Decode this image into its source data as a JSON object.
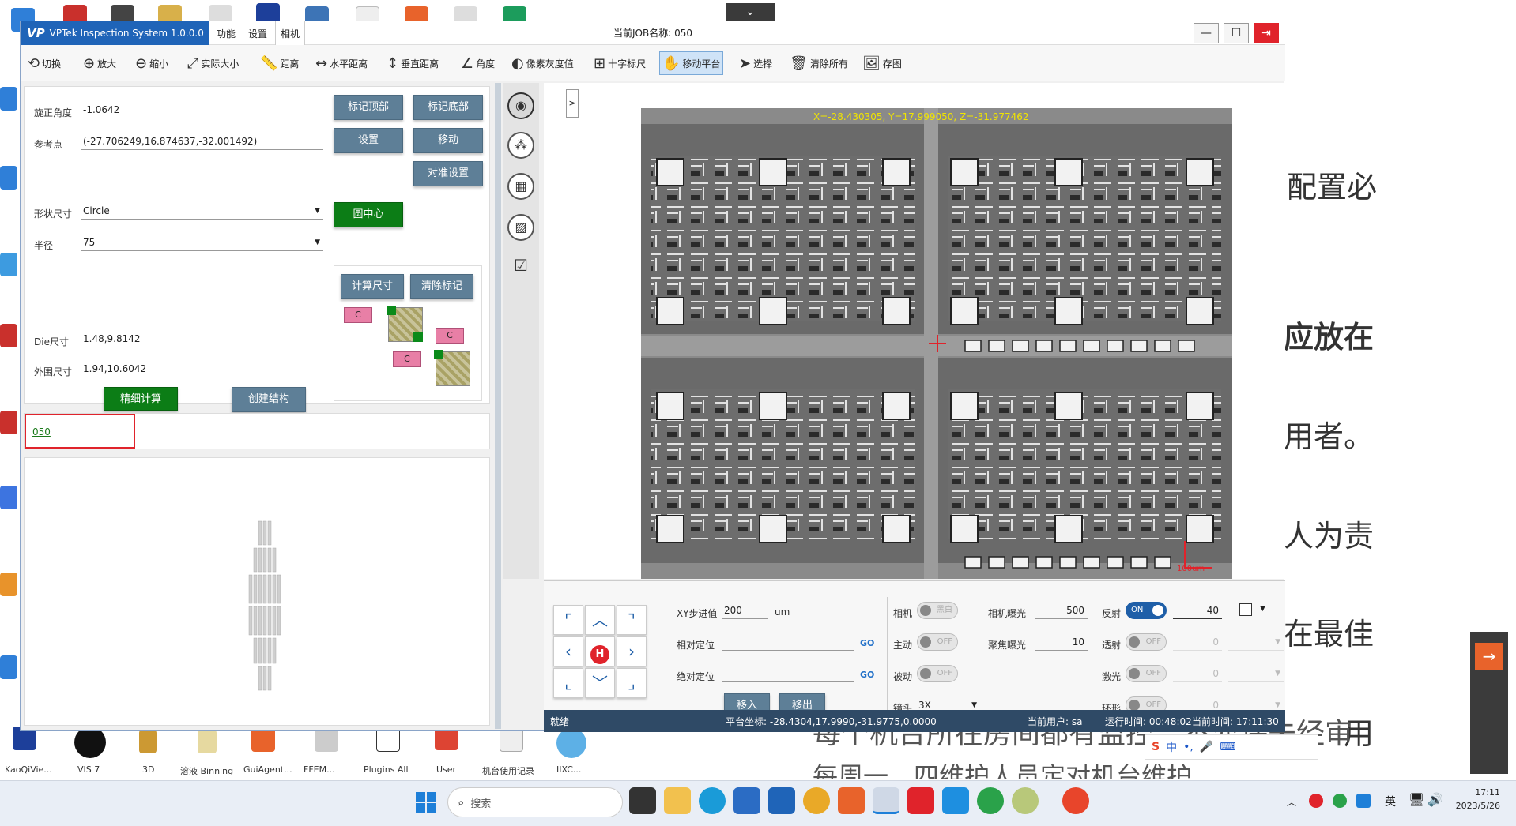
{
  "app": {
    "logo": "VP",
    "title": "VPTek Inspection System 1.0.0.0",
    "menu": [
      "功能",
      "设置",
      "相机"
    ],
    "job_label": "当前JOB名称: 050",
    "window_controls": [
      "minimize-icon",
      "maximize-icon",
      "exit-icon"
    ]
  },
  "toolbar": [
    {
      "icon": "refresh-icon",
      "label": "切换"
    },
    {
      "icon": "zoom-in-icon",
      "label": "放大"
    },
    {
      "icon": "zoom-out-icon",
      "label": "缩小"
    },
    {
      "icon": "fit-icon",
      "label": "实际大小"
    },
    {
      "icon": "ruler-icon",
      "label": "距离"
    },
    {
      "icon": "horizontal-distance-icon",
      "label": "水平距离"
    },
    {
      "icon": "vertical-distance-icon",
      "label": "垂直距离"
    },
    {
      "icon": "angle-icon",
      "label": "角度"
    },
    {
      "icon": "gray-value-icon",
      "label": "像素灰度值"
    },
    {
      "icon": "crosshair-icon",
      "label": "十字标尺"
    },
    {
      "icon": "hand-move-icon",
      "label": "移动平台"
    },
    {
      "icon": "pointer-icon",
      "label": "选择"
    },
    {
      "icon": "trash-icon",
      "label": "清除所有"
    },
    {
      "icon": "save-image-icon",
      "label": "存图"
    }
  ],
  "form": {
    "rotation_label": "旋正角度",
    "rotation_value": "-1.0642",
    "ref_label": "参考点",
    "ref_value": "(-27.706249,16.874637,-32.001492)",
    "shape_label": "形状尺寸",
    "shape_value": "Circle",
    "radius_label": "半径",
    "radius_value": "75",
    "die_label": "Die尺寸",
    "die_value": "1.48,9.8142",
    "outer_label": "外围尺寸",
    "outer_value": "1.94,10.6042",
    "btn_mark_top": "标记顶部",
    "btn_mark_bottom": "标记底部",
    "btn_setup": "设置",
    "btn_move": "移动",
    "btn_align": "对准设置",
    "btn_circle_center": "圆中心",
    "btn_calc_size": "计算尺寸",
    "btn_clear_mark": "清除标记",
    "btn_precise": "精细计算",
    "btn_create": "创建结构",
    "mark_letter": "C"
  },
  "job_link": "050",
  "image": {
    "coords_text": "X=-28.430305, Y=17.999050, Z=-31.977462",
    "scale_label": "100um",
    "expand_btn": ">"
  },
  "sidebar_icons": [
    "camera-icon",
    "bga-icon",
    "grid-icon",
    "image-icon",
    "checklist-icon"
  ],
  "motion": {
    "xy_step_label": "XY步进值",
    "xy_step_value": "200",
    "unit": "um",
    "rel_label": "相对定位",
    "abs_label": "绝对定位",
    "go": "GO",
    "home": "H",
    "move_in": "移入",
    "move_out": "移出"
  },
  "camera": {
    "camera_label": "相机",
    "camera_toggle": "黑白",
    "active_label": "主动",
    "passive_label": "被动",
    "off": "OFF",
    "on": "ON",
    "lens_label": "镜头",
    "lens_value": "3X",
    "exposure_label": "相机曝光",
    "exposure_value": "500",
    "focus_exp_label": "聚焦曝光",
    "focus_exp_value": "10",
    "reflect_label": "反射",
    "reflect_value": "40",
    "transmit_label": "透射",
    "transmit_value": "0",
    "laser_label": "激光",
    "laser_value": "0",
    "ring_label": "环形",
    "ring_value": "0"
  },
  "status": {
    "ready": "就绪",
    "platform": "平台坐标: -28.4304,17.9990,-31.9775,0.0000",
    "user": "当前用户: sa",
    "runtime": "运行时间: 00:48:02",
    "curtime": "当前时间: 17:11:30"
  },
  "desktop": {
    "doc_lines": [
      "配置必",
      "应放在",
      "用者。",
      "人为责",
      "在最佳",
      "用"
    ],
    "icon_labels": [
      "KaoQiVie...",
      "VIS 7",
      "3D",
      "溶液 Binning",
      "GuiAgent...",
      "FFEM...",
      "Plugins All",
      "User",
      "机台使用记录",
      "IIXC..."
    ],
    "bottom_text": "每个机台所在房间都有监控，不允许未经审批的机台使用",
    "bottom_text2": "每周一、四维护人员定对机台维护"
  },
  "taskbar": {
    "search_placeholder": "搜索",
    "ime": "英",
    "time": "17:11",
    "date": "2023/5/26"
  }
}
